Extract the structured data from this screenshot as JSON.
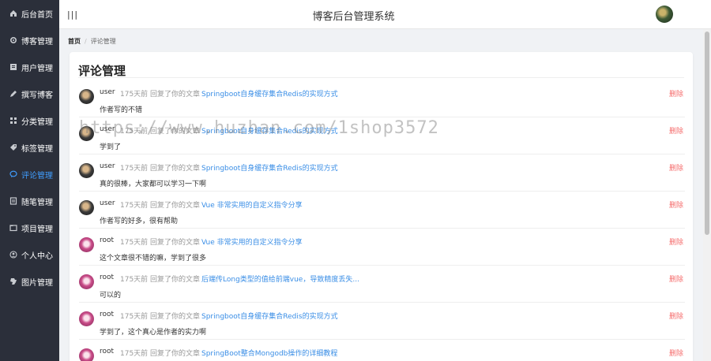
{
  "sidebar": {
    "items": [
      {
        "label": "后台首页",
        "icon": "home-icon"
      },
      {
        "label": "博客管理",
        "icon": "gear-icon"
      },
      {
        "label": "用户管理",
        "icon": "user-icon"
      },
      {
        "label": "撰写博客",
        "icon": "edit-icon"
      },
      {
        "label": "分类管理",
        "icon": "grid-icon"
      },
      {
        "label": "标签管理",
        "icon": "tag-icon"
      },
      {
        "label": "评论管理",
        "icon": "comment-icon",
        "active": true
      },
      {
        "label": "随笔管理",
        "icon": "note-icon"
      },
      {
        "label": "项目管理",
        "icon": "folder-icon"
      },
      {
        "label": "个人中心",
        "icon": "person-icon"
      },
      {
        "label": "图片管理",
        "icon": "image-icon"
      }
    ],
    "active_color": "#409eff",
    "bg_color": "#2b2f3a"
  },
  "header": {
    "menu_icon": "|||",
    "title": "博客后台管理系统"
  },
  "breadcrumb": {
    "home": "首页",
    "separator": "/",
    "current": "评论管理"
  },
  "card": {
    "title": "评论管理"
  },
  "comments": [
    {
      "user": "user",
      "time": "175天前",
      "action": "回复了你的文章",
      "article": "Springboot自身缓存集合Redis的实现方式",
      "content": "作者写的不错",
      "delete": "删除",
      "avatar": "user"
    },
    {
      "user": "user",
      "time": "175天前",
      "action": "回复了你的文章",
      "article": "Springboot自身缓存集合Redis的实现方式",
      "content": "学到了",
      "delete": "删除",
      "avatar": "user"
    },
    {
      "user": "user",
      "time": "175天前",
      "action": "回复了你的文章",
      "article": "Springboot自身缓存集合Redis的实现方式",
      "content": "真的很棒，大家都可以学习一下啊",
      "delete": "删除",
      "avatar": "user"
    },
    {
      "user": "user",
      "time": "175天前",
      "action": "回复了你的文章",
      "article": "Vue 非常实用的自定义指令分享",
      "content": "作者写的好多，很有帮助",
      "delete": "删除",
      "avatar": "user"
    },
    {
      "user": "root",
      "time": "175天前",
      "action": "回复了你的文章",
      "article": "Vue 非常实用的自定义指令分享",
      "content": "这个文章很不错的嘛，学到了很多",
      "delete": "删除",
      "avatar": "root"
    },
    {
      "user": "root",
      "time": "175天前",
      "action": "回复了你的文章",
      "article": "后端传Long类型的值给前端vue，导致精度丢失...",
      "content": "可以的",
      "delete": "删除",
      "avatar": "root"
    },
    {
      "user": "root",
      "time": "175天前",
      "action": "回复了你的文章",
      "article": "Springboot自身缓存集合Redis的实现方式",
      "content": "学到了，这个真心是作者的实力啊",
      "delete": "删除",
      "avatar": "root"
    },
    {
      "user": "root",
      "time": "175天前",
      "action": "回复了你的文章",
      "article": "SpringBoot整合Mongodb操作的详细教程",
      "content": "",
      "delete": "删除",
      "avatar": "root"
    }
  ],
  "watermark": "https://www.huzhan.com/1shop3572",
  "colors": {
    "link": "#3a8ee6",
    "delete": "#f56c6c"
  }
}
